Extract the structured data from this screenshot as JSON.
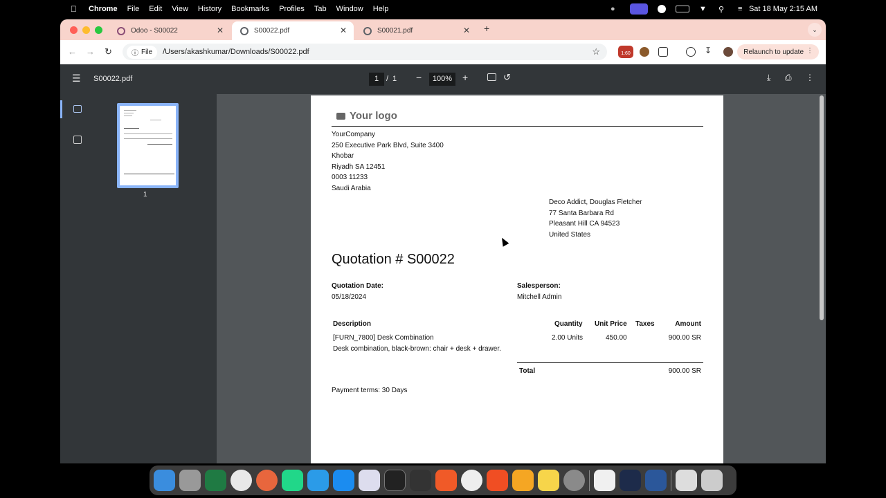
{
  "menubar": {
    "app": "Chrome",
    "items": [
      "File",
      "Edit",
      "View",
      "History",
      "Bookmarks",
      "Profiles",
      "Tab",
      "Window",
      "Help"
    ],
    "clock": "Sat 18 May  2:15 AM"
  },
  "tabs": [
    {
      "title": "Odoo - S00022"
    },
    {
      "title": "S00022.pdf"
    },
    {
      "title": "S00021.pdf"
    }
  ],
  "toolbar": {
    "chip": "File",
    "url": "/Users/akashkumar/Downloads/S00022.pdf",
    "ext_badge": "1:60",
    "relaunch": "Relaunch to update"
  },
  "pdf": {
    "filename": "S00022.pdf",
    "page": "1",
    "page_sep": "/",
    "page_total": "1",
    "zoom": "100%",
    "thumb_label": "1"
  },
  "document": {
    "logo": "Your logo",
    "company": [
      "YourCompany",
      "250 Executive Park Blvd, Suite 3400",
      "Khobar",
      "Riyadh SA 12451",
      "0003 11233",
      "Saudi Arabia"
    ],
    "customer": [
      "Deco Addict, Douglas Fletcher",
      "77 Santa Barbara Rd",
      "Pleasant Hill CA 94523",
      "United States"
    ],
    "title": "Quotation # S00022",
    "date_label": "Quotation Date:",
    "date": "05/18/2024",
    "sales_label": "Salesperson:",
    "salesperson": "Mitchell Admin",
    "headers": {
      "description": "Description",
      "quantity": "Quantity",
      "unit_price": "Unit Price",
      "taxes": "Taxes",
      "amount": "Amount"
    },
    "line": {
      "name": "[FURN_7800] Desk Combination",
      "detail": "Desk combination, black-brown: chair + desk + drawer.",
      "quantity": "2.00 Units",
      "unit_price": "450.00",
      "taxes": "",
      "amount": "900.00 SR"
    },
    "total_label": "Total",
    "total": "900.00 SR",
    "terms": "Payment terms: 30 Days"
  },
  "colors": {
    "tabstrip": "#f8d4cc",
    "pdf_toolbar": "#323639",
    "viewer_bg": "#525659",
    "thumb_border": "#8ab4f8"
  }
}
